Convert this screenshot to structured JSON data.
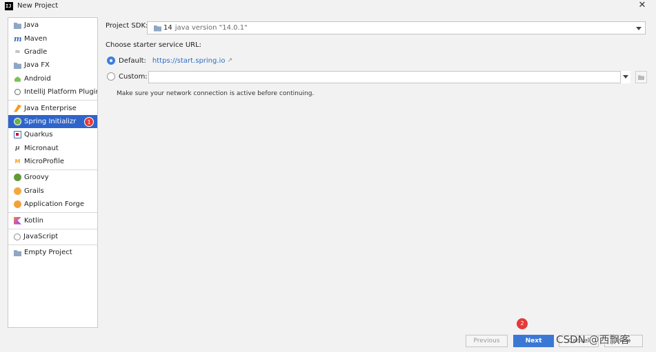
{
  "window": {
    "title": "New Project",
    "close_glyph": "✕"
  },
  "sidebar": {
    "groups": [
      {
        "items": [
          {
            "label": "Java",
            "icon": "folder-icon"
          },
          {
            "label": "Maven",
            "icon": "maven-icon"
          },
          {
            "label": "Gradle",
            "icon": "gradle-icon"
          },
          {
            "label": "Java FX",
            "icon": "folder-icon"
          },
          {
            "label": "Android",
            "icon": "android-icon"
          },
          {
            "label": "IntelliJ Platform Plugin",
            "icon": "intellij-icon"
          }
        ]
      },
      {
        "items": [
          {
            "label": "Java Enterprise",
            "icon": "java-enterprise-icon"
          },
          {
            "label": "Spring Initializr",
            "icon": "spring-icon",
            "selected": true,
            "badge": "1"
          },
          {
            "label": "Quarkus",
            "icon": "quarkus-icon"
          },
          {
            "label": "Micronaut",
            "icon": "micronaut-icon"
          },
          {
            "label": "MicroProfile",
            "icon": "microprofile-icon"
          }
        ]
      },
      {
        "items": [
          {
            "label": "Groovy",
            "icon": "groovy-icon"
          },
          {
            "label": "Grails",
            "icon": "grails-icon"
          },
          {
            "label": "Application Forge",
            "icon": "application-forge-icon"
          }
        ]
      },
      {
        "items": [
          {
            "label": "Kotlin",
            "icon": "kotlin-icon"
          }
        ]
      },
      {
        "items": [
          {
            "label": "JavaScript",
            "icon": "javascript-icon"
          }
        ]
      },
      {
        "items": [
          {
            "label": "Empty Project",
            "icon": "folder-icon"
          }
        ]
      }
    ]
  },
  "main": {
    "sdk_label": "Project SDK:",
    "sdk_version": "14",
    "sdk_desc": "java version \"14.0.1\"",
    "url_label": "Choose starter service URL:",
    "default_label": "Default:",
    "default_url": "https://start.spring.io",
    "ext_glyph": "↗",
    "custom_label": "Custom:",
    "custom_value": "",
    "hint": "Make sure your network connection is active before continuing."
  },
  "footer": {
    "previous": "Previous",
    "next": "Next",
    "cancel": "Cancel",
    "help": "Help",
    "badge": "2",
    "watermark": "CSDN @西飘客"
  }
}
